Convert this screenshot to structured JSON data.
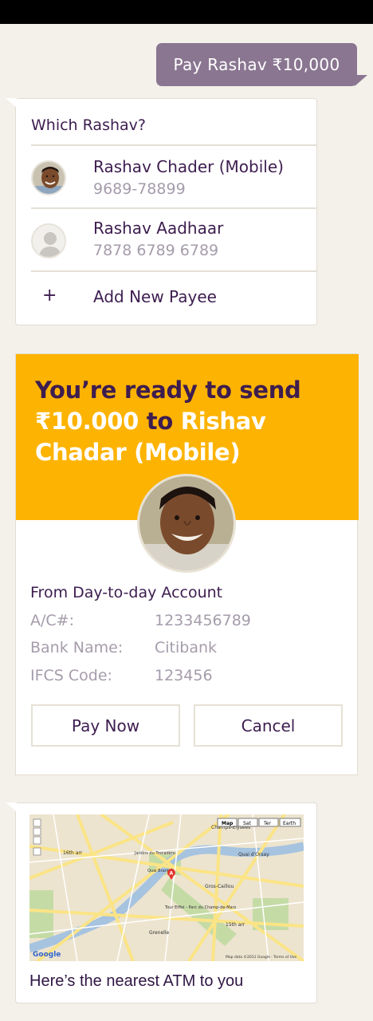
{
  "conversation": {
    "user_message": "Pay Rashav  ₹10,000",
    "which_card": {
      "title": "Which Rashav?",
      "payees": [
        {
          "name": "Rashav Chader (Mobile)",
          "number": "9689-78899",
          "avatar": "person-photo"
        },
        {
          "name": "Rashav Aadhaar",
          "number": "7878 6789 6789",
          "avatar": "default-person-icon"
        }
      ],
      "add_icon": "+",
      "add_label": "Add New Payee"
    },
    "ready_card": {
      "title_line1": "You’re ready to send",
      "amount": "₹10.000",
      "to_word": "to",
      "recipient": "Rishav Chadar (Mobile)",
      "from_title": "From Day-to-day Account",
      "details": [
        {
          "label": "A/C#:",
          "value": "1233456789"
        },
        {
          "label": "Bank Name:",
          "value": "Citibank"
        },
        {
          "label": "IFCS Code:",
          "value": "123456"
        }
      ],
      "pay_label": "Pay Now",
      "cancel_label": "Cancel"
    },
    "map_card": {
      "map_type_buttons": [
        "Map",
        "Sat",
        "Ter",
        "Earth"
      ],
      "map_places": [
        "Champs-Élysées",
        "16th arr",
        "Quai d'Orsay",
        "Gros-Caillou",
        "Tour Eiffel - Parc du Champ-de-Mars",
        "Quai Branly",
        "Jardins du Trocadéro",
        "Grenelle",
        "15th arr"
      ],
      "attribution": "Map data ©2011 Google - Terms of Use",
      "logo": "Google",
      "caption": "Here’s the nearest ATM to you"
    }
  },
  "colors": {
    "background": "#f4f0ea",
    "user_bubble": "#8a7691",
    "banner": "#fdb302",
    "primary_text": "#3d1d4f",
    "muted_text": "#a59cab"
  }
}
